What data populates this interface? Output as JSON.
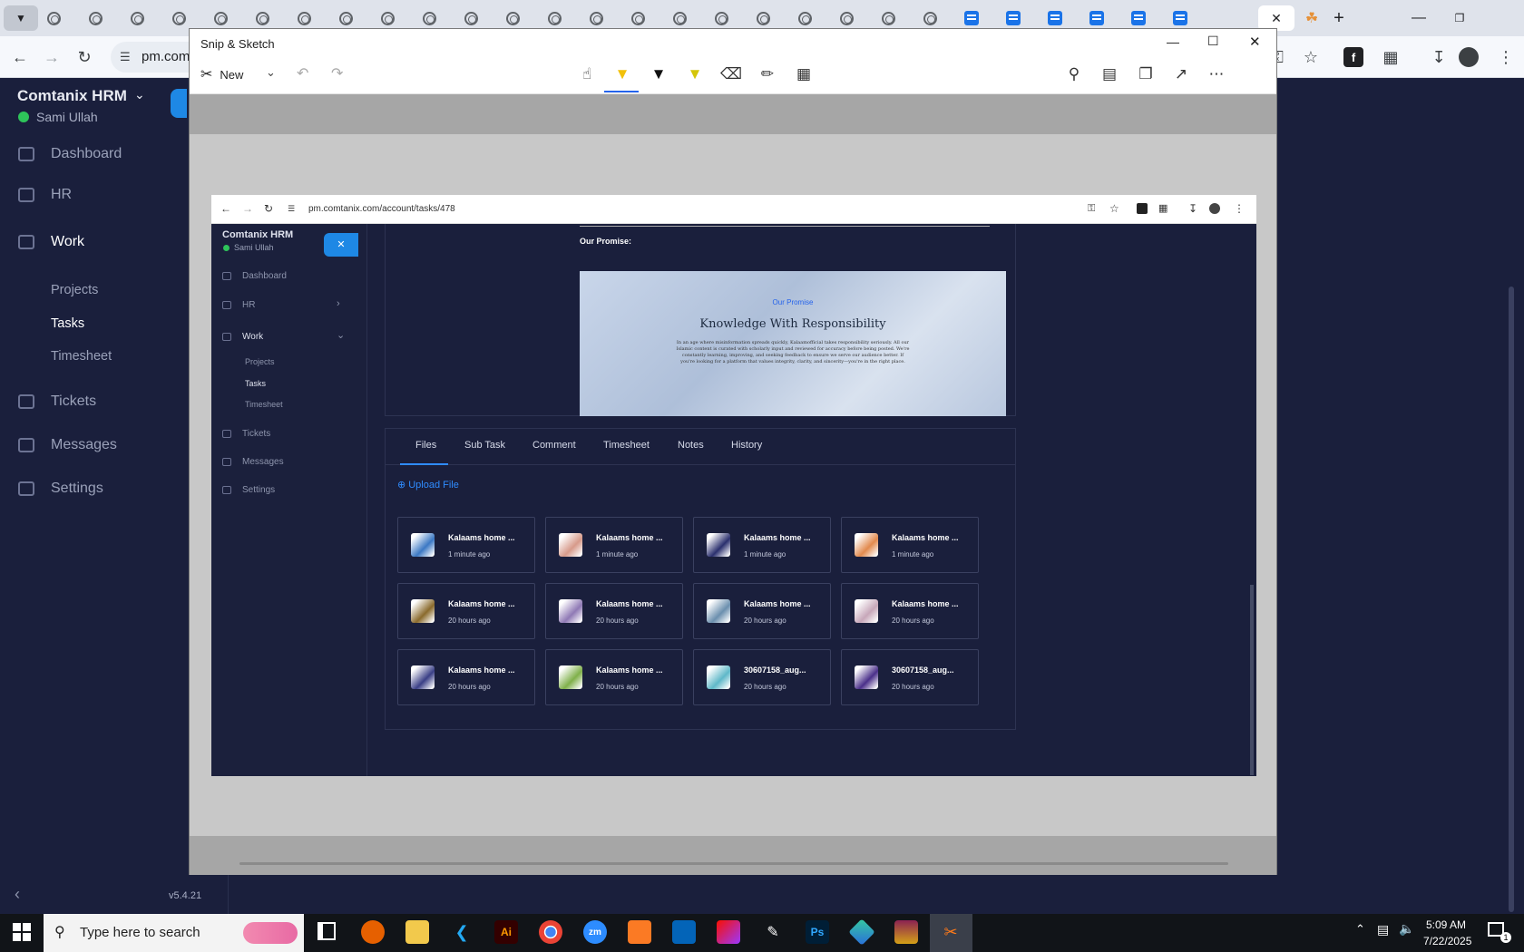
{
  "browser": {
    "url_partial": "pm.com",
    "tab_count": 28
  },
  "bg_app": {
    "brand": "Comtanix HRM",
    "user": "Sami Ullah",
    "nav": [
      {
        "label": "Dashboard",
        "icon": "home-icon"
      },
      {
        "label": "HR",
        "icon": "users-icon"
      },
      {
        "label": "Work",
        "icon": "briefcase-icon"
      },
      {
        "label": "Tickets",
        "icon": "headset-icon"
      },
      {
        "label": "Messages",
        "icon": "message-icon"
      },
      {
        "label": "Settings",
        "icon": "gear-icon"
      }
    ],
    "work_sub": [
      "Projects",
      "Tasks",
      "Timesheet"
    ],
    "version": "v5.4.21"
  },
  "snip": {
    "title": "Snip & Sketch",
    "new_label": "New",
    "tools": [
      "touch-writing-icon",
      "ballpoint-pen-icon",
      "pencil-icon",
      "highlighter-icon",
      "eraser-icon",
      "ruler-icon",
      "crop-icon"
    ],
    "right_tools": [
      "zoom-icon",
      "save-icon",
      "copy-icon",
      "share-icon",
      "more-icon"
    ]
  },
  "inner": {
    "url": "pm.comtanix.com/account/tasks/478",
    "brand": "Comtanix HRM",
    "user": "Sami Ullah",
    "nav": [
      "Dashboard",
      "HR",
      "Work",
      "Tickets",
      "Messages",
      "Settings"
    ],
    "work_sub": [
      "Projects",
      "Tasks",
      "Timesheet"
    ],
    "promise_heading": "Our Promise:",
    "promise_kicker": "Our Promise",
    "promise_title": "Knowledge With Responsibility",
    "promise_body": "In an age where misinformation spreads quickly, Kalaamofficial takes responsibility seriously. All our Islamic content is curated with scholarly input and reviewed for accuracy before being posted. We're constantly learning, improving, and seeking feedback to ensure we serve our audience better. If you're looking for a platform that values integrity, clarity, and sincerity—you're in the right place.",
    "tabs": [
      "Files",
      "Sub Task",
      "Comment",
      "Timesheet",
      "Notes",
      "History"
    ],
    "active_tab": "Files",
    "upload_label": "Upload File",
    "files": [
      {
        "name": "Kalaams home ...",
        "time": "1 minute ago",
        "color": "#3b78c4"
      },
      {
        "name": "Kalaams home ...",
        "time": "1 minute ago",
        "color": "#d79a8a"
      },
      {
        "name": "Kalaams home ...",
        "time": "1 minute ago",
        "color": "#2a2f6e"
      },
      {
        "name": "Kalaams home ...",
        "time": "1 minute ago",
        "color": "#e28a4e"
      },
      {
        "name": "Kalaams home ...",
        "time": "20 hours ago",
        "color": "#8a6a2c"
      },
      {
        "name": "Kalaams home ...",
        "time": "20 hours ago",
        "color": "#8f79b5"
      },
      {
        "name": "Kalaams home ...",
        "time": "20 hours ago",
        "color": "#6b8fae"
      },
      {
        "name": "Kalaams home ...",
        "time": "20 hours ago",
        "color": "#c7a7b9"
      },
      {
        "name": "Kalaams home ...",
        "time": "20 hours ago",
        "color": "#3a3f86"
      },
      {
        "name": "Kalaams home ...",
        "time": "20 hours ago",
        "color": "#7fb04a"
      },
      {
        "name": "30607158_aug...",
        "time": "20 hours ago",
        "color": "#5fb8c9"
      },
      {
        "name": "30607158_aug...",
        "time": "20 hours ago",
        "color": "#4a2f8a"
      }
    ]
  },
  "taskbar": {
    "search_placeholder": "Type here to search",
    "time": "5:09 AM",
    "date": "7/22/2025",
    "notification_count": "1",
    "apps": [
      "firefox-icon",
      "file-explorer-icon",
      "vscode-icon",
      "illustrator-icon",
      "chrome-icon",
      "zoom-icon",
      "xampp-icon",
      "outlook-icon",
      "creative-cloud-icon",
      "pen-icon",
      "photoshop-icon",
      "app-icon",
      "winrar-icon",
      "snip-sketch-icon"
    ],
    "ai_label": "Ai",
    "ps_label": "Ps",
    "zm_label": "zm"
  }
}
